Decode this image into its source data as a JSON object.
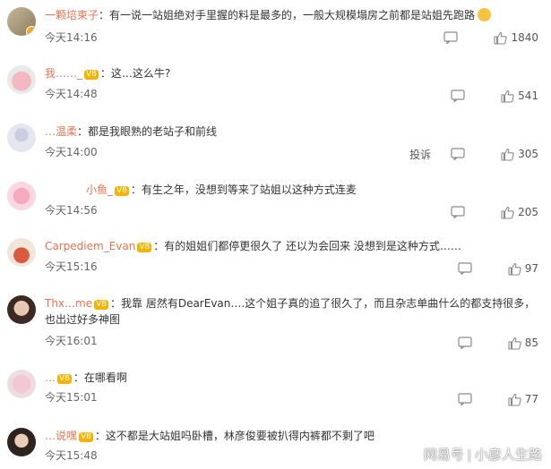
{
  "comments": [
    {
      "username": "一颗培束子",
      "vip": "",
      "text": "有一说一站姐绝对手里握的料是最多的，一般大规模塌房之前都是站姐先跑路",
      "time": "今天14:16",
      "likes": "1840",
      "report": ""
    },
    {
      "username": "我……_",
      "vip": "V8",
      "text": "这…这么牛?",
      "time": "今天14:48",
      "likes": "541",
      "report": ""
    },
    {
      "username": "…温柔",
      "vip": "",
      "text": "都是我眼熟的老站子和前线",
      "time": "今天14:00",
      "likes": "305",
      "report": "投诉"
    },
    {
      "username": "小鱼_",
      "vip": "V8",
      "text": "有生之年，没想到等来了站姐以这种方式连麦",
      "time": "今天14:56",
      "likes": "205",
      "report": ""
    },
    {
      "username": "Carpediem_Evan",
      "vip": "V8",
      "text": "有的姐姐们都停更很久了 还以为会回来 没想到是这种方式……",
      "time": "今天15:16",
      "likes": "97",
      "report": ""
    },
    {
      "username": "Thx…me",
      "vip": "V8",
      "text": "我靠 居然有DearEvan….这个姐子真的追了很久了，而且杂志单曲什么的都支持很多，也出过好多神图",
      "time": "今天16:01",
      "likes": "85",
      "report": ""
    },
    {
      "username": "…",
      "vip": "V8",
      "text": "在哪看啊",
      "time": "今天15:01",
      "likes": "77",
      "report": ""
    },
    {
      "username": "…说嘿",
      "vip": "V8",
      "text": "这不都是大站姐吗卧槽，林彦俊要被扒得内裤都不剩了吧",
      "time": "今天15:48",
      "likes": "",
      "report": ""
    }
  ],
  "icons": {
    "reply": "comment-icon",
    "like": "thumbs-up-icon"
  },
  "watermark": "网易号 | 小彦人生路",
  "colors": {
    "username": "#eb7350",
    "text": "#333333",
    "time": "#666666"
  }
}
